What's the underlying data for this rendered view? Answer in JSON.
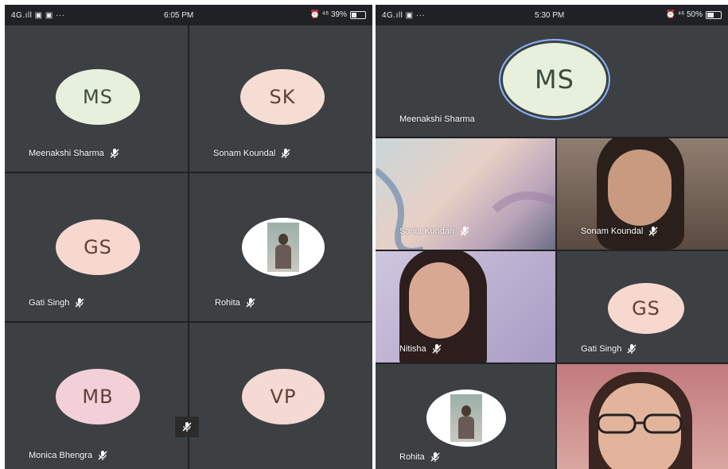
{
  "left": {
    "status_left": "4G.ıll  ▣ ▣ ···",
    "time": "6:05 PM",
    "status_right": "⏰ ⁴⁶ 39%",
    "tiles": [
      {
        "initials": "MS",
        "name": "Meenakshi Sharma",
        "color": "#e6f0dc"
      },
      {
        "initials": "SK",
        "name": "Sonam Koundal",
        "color": "#f6ddd4"
      },
      {
        "initials": "GS",
        "name": "Gati Singh",
        "color": "#f7d8cf"
      },
      {
        "initials": "",
        "name": "Rohita",
        "color": "#ffffff"
      },
      {
        "initials": "MB",
        "name": "Monica Bhengra",
        "color": "#f3cfd8"
      },
      {
        "initials": "VP",
        "name": "",
        "color": "#f5d9d3"
      }
    ]
  },
  "right": {
    "status_left": "4G.ıll  ▣ ···",
    "time": "5:30 PM",
    "status_right": "⏰ ⁴⁶ 50%",
    "featured": {
      "initials": "MS",
      "name": "Meenakshi Sharma",
      "color": "#e6f0dc"
    },
    "tiles": [
      {
        "name": "Sania Kundan"
      },
      {
        "name": "Sonam Koundal"
      },
      {
        "name": "Nitisha"
      },
      {
        "initials": "GS",
        "name": "Gati Singh",
        "color": "#f7d8cf"
      },
      {
        "name": "Rohita"
      },
      {
        "name": ""
      }
    ]
  },
  "icons": {
    "mic_off": "mic-off-icon"
  }
}
